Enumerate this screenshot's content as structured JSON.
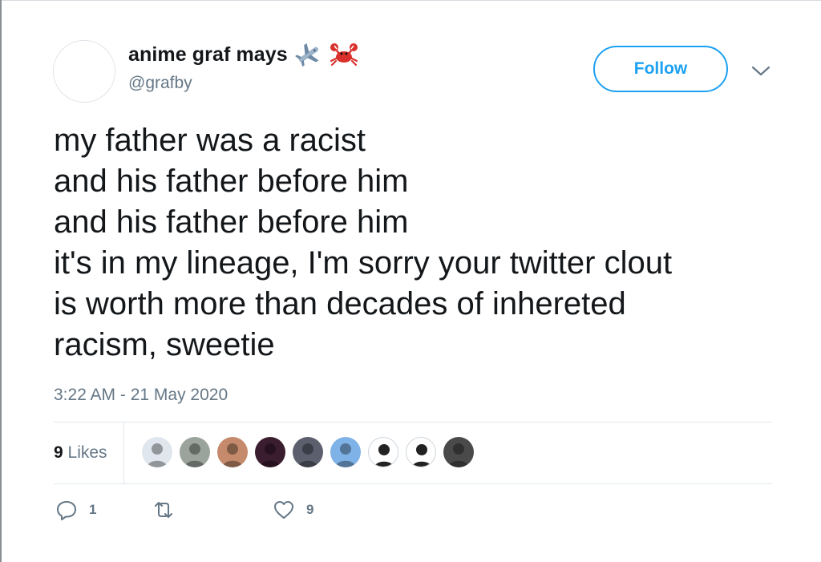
{
  "user": {
    "display_name": "anime graf mays",
    "handle": "@grafby",
    "name_emojis": [
      "airplane-icon",
      "crab-icon"
    ]
  },
  "follow_label": "Follow",
  "tweet": {
    "text": "my father was a racist\nand his father before him\nand his father before him\nit's in my lineage, I'm sorry your twitter clout\nis worth more than decades of inhereted\nracism, sweetie",
    "timestamp": "3:22 AM - 21 May 2020"
  },
  "likes": {
    "count": "9",
    "label": "Likes",
    "avatar_colors": [
      "#dfe6ee",
      "#9aa39c",
      "#c48a6b",
      "#3a1d2e",
      "#5b5f6e",
      "#7fb2e6",
      "#ffffff",
      "#ffffff",
      "#4a4a4a"
    ]
  },
  "actions": {
    "reply_count": "1",
    "retweet_count": "",
    "like_count": "9"
  },
  "colors": {
    "accent": "#1da1f2",
    "muted": "#657786",
    "text": "#14171a",
    "divider": "#e1e8ed"
  }
}
